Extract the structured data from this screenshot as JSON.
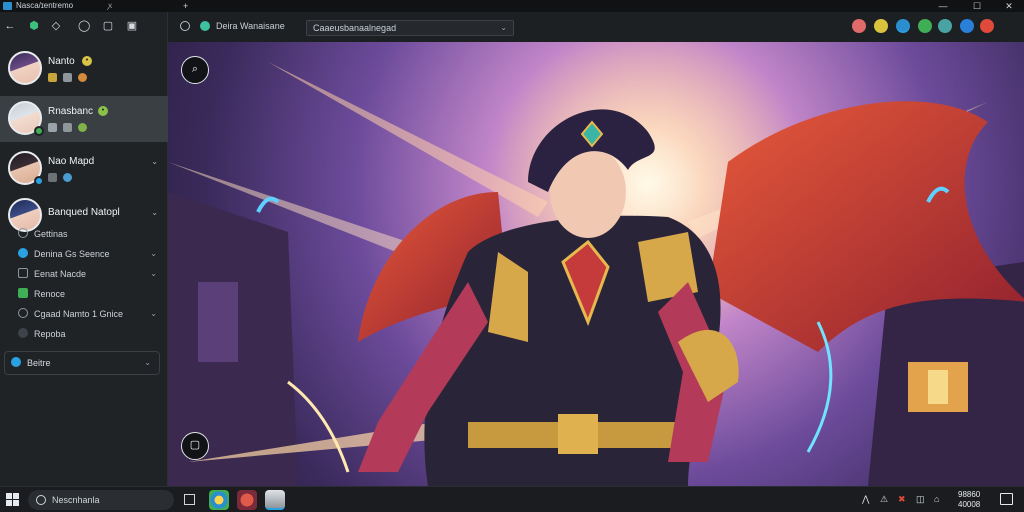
{
  "window": {
    "title": "Nasca/ɪentremo",
    "tab_close": "ꭗ",
    "new_tab": "+",
    "minimize": "—",
    "maximize": "☐",
    "close": "✕"
  },
  "sidebar": {
    "toolbar_icons": [
      "back-icon",
      "shield-icon",
      "diamond-icon",
      "chat-icon",
      "compose-icon",
      "window-icon"
    ],
    "chats": [
      {
        "name": "Nanto",
        "badge_color": "#d8c545",
        "sub_colors": [
          "#c9a43d",
          "#8e969c",
          "#d48b3c"
        ]
      },
      {
        "name": "Rnasbanc",
        "badge_color": "#8bc34a",
        "sub_colors": [
          "#9aa3aa",
          "#8e969c",
          "#7fb34a"
        ],
        "selected": true
      },
      {
        "name": "Nao Mapd",
        "badge_color": "",
        "sub_colors": [
          "#6b7379",
          "#4a9bcf"
        ]
      },
      {
        "name": "Banqued Natopl",
        "badge_color": "",
        "sub_colors": []
      }
    ],
    "sub_items": [
      {
        "label": "Gettinas",
        "icon_color": "#6b7379"
      },
      {
        "label": "Denina Gs Seence",
        "icon_color": "#2aa1e0"
      },
      {
        "label": "Eenat Nacde",
        "icon_color": "#8e969c"
      },
      {
        "label": "Renoce",
        "icon_color": "#3fae54"
      },
      {
        "label": "Cgaad Namto 1 Gnice",
        "icon_color": "#6b7379"
      },
      {
        "label": "Repoba",
        "icon_color": "#6b7379"
      }
    ],
    "footer_label": "Beitre"
  },
  "header": {
    "left_label": "Deira   Wanaisane",
    "select_value": "Caaeusbanaalnegad",
    "right_icons": [
      {
        "name": "avatar-icon",
        "color": "#e06a6a"
      },
      {
        "name": "emoji-icon",
        "color": "#d9c33c"
      },
      {
        "name": "globe-icon",
        "color": "#2a8ecf"
      },
      {
        "name": "leaf-icon",
        "color": "#3fae54"
      },
      {
        "name": "grid-icon",
        "color": "#4aa3a3"
      },
      {
        "name": "star-icon",
        "color": "#2a7fd8"
      },
      {
        "name": "close-circle-icon",
        "color": "#e04a3a"
      }
    ]
  },
  "canvas": {
    "zoom_glyph": "⌕",
    "bottom_glyph": "▢"
  },
  "taskbar": {
    "search_text": "Nescnhanla",
    "apps": [
      "#2a8ecf",
      "#e05a4a",
      "#d8dde2"
    ],
    "tray_glyphs": [
      "⋀",
      "⚠",
      "✖",
      "◫",
      "⌂"
    ],
    "clock_time": "98860",
    "clock_date": "40008"
  }
}
